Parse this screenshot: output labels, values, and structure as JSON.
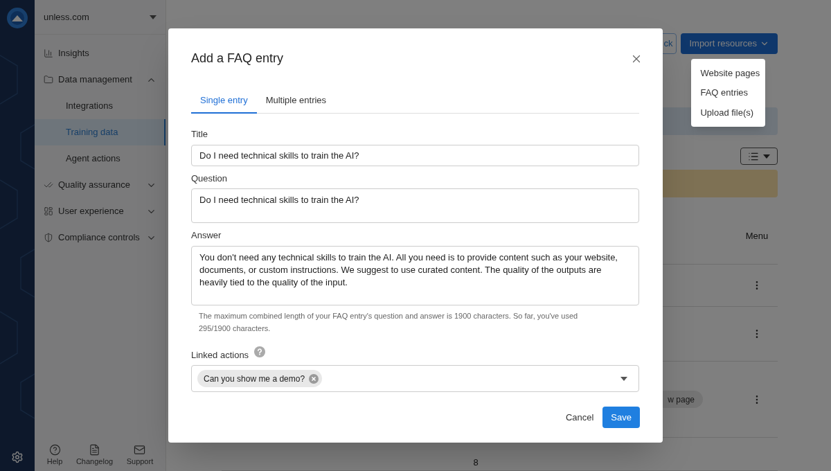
{
  "sidebar": {
    "workspace": "unless.com",
    "items": [
      {
        "kind": "link",
        "label": "Insights"
      },
      {
        "kind": "group",
        "label": "Data management",
        "expanded": true,
        "children": [
          {
            "label": "Integrations",
            "selected": false
          },
          {
            "label": "Training data",
            "selected": true
          },
          {
            "label": "Agent actions",
            "selected": false
          }
        ]
      },
      {
        "kind": "group",
        "label": "Quality assurance",
        "expanded": false
      },
      {
        "kind": "group",
        "label": "User experience",
        "expanded": false
      },
      {
        "kind": "group",
        "label": "Compliance controls",
        "expanded": false
      }
    ],
    "footer": [
      "Help",
      "Changelog",
      "Support"
    ]
  },
  "main": {
    "buttons": [
      {
        "kind": "outline",
        "label": "ck"
      },
      {
        "kind": "primary",
        "label": "Import resources"
      }
    ],
    "import_menu": [
      "Website pages",
      "FAQ entries",
      "Upload file(s)"
    ],
    "table": {
      "columns": [
        "Menu"
      ],
      "rows": [
        {},
        {},
        {
          "chip": "w page"
        },
        {
          "count": "8"
        }
      ]
    }
  },
  "dialog": {
    "title": "Add a FAQ entry",
    "tabs": [
      {
        "label": "Single entry",
        "selected": true
      },
      {
        "label": "Multiple entries",
        "selected": false
      }
    ],
    "fields": [
      {
        "kind": "input",
        "label": "Title",
        "value": "Do I need technical skills to train the AI?"
      },
      {
        "kind": "textarea",
        "label": "Question",
        "value": "Do I need technical skills to train the AI?"
      },
      {
        "kind": "textarea",
        "label": "Answer",
        "value": "You don't need any technical skills to train the AI. All you need is to provide content such as your website, documents, or custom instructions. We suggest to use curated content. The quality of the outputs are heavily tied to the quality of the input.",
        "hint": "The maximum combined length of your FAQ entry's question and answer is 1900 characters. So far, you've used 295/1900 characters."
      }
    ],
    "linked_actions": {
      "label": "Linked actions",
      "tags": [
        "Can you show me a demo?"
      ]
    },
    "buttons": [
      {
        "kind": "text",
        "label": "Cancel"
      },
      {
        "kind": "primary",
        "label": "Save"
      }
    ]
  }
}
